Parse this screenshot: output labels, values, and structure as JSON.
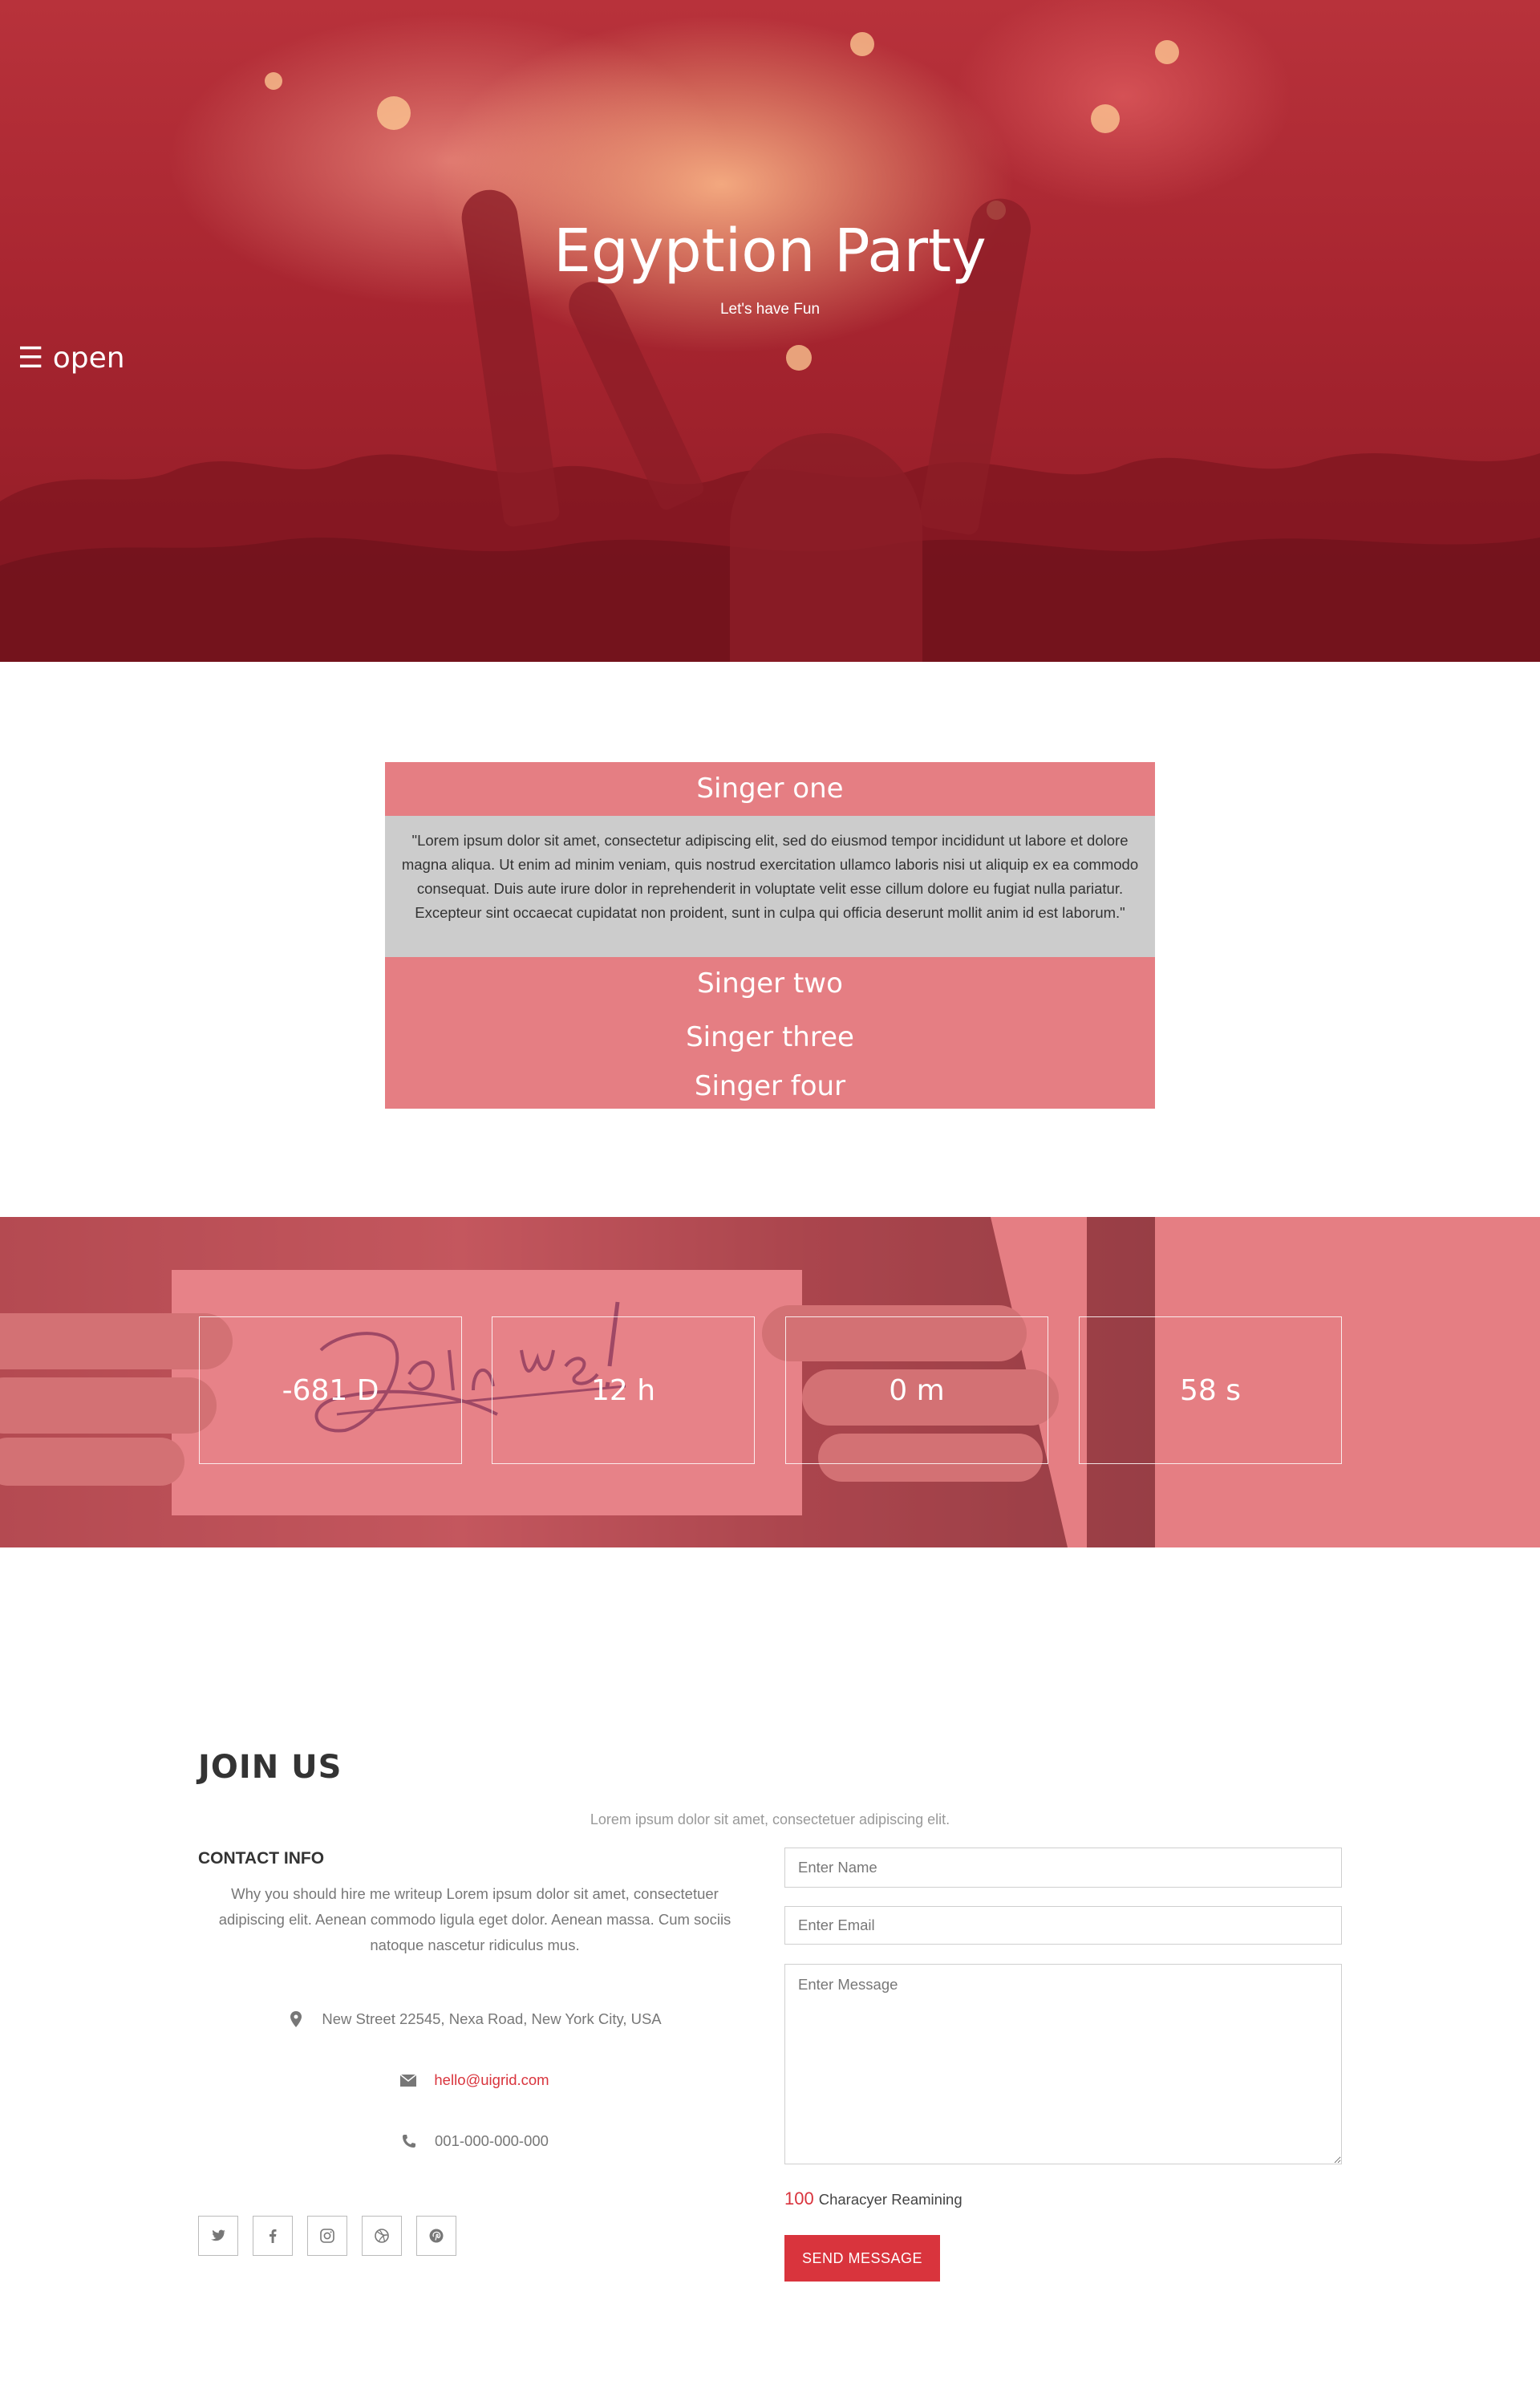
{
  "hero": {
    "title": "Egyption Party",
    "subtitle": "Let's have Fun",
    "menu_toggle": "☰ open",
    "menu_toggle_icon": "hamburger-icon"
  },
  "accordion": {
    "items": [
      {
        "title": "Singer one",
        "expanded": true,
        "body": "\"Lorem ipsum dolor sit amet, consectetur adipiscing elit, sed do eiusmod tempor incididunt ut labore et dolore magna aliqua. Ut enim ad minim veniam, quis nostrud exercitation ullamco laboris nisi ut aliquip ex ea commodo consequat. Duis aute irure dolor in reprehenderit in voluptate velit esse cillum dolore eu fugiat nulla pariatur. Excepteur sint occaecat cupidatat non proident, sunt in culpa qui officia deserunt mollit anim id est laborum.\""
      },
      {
        "title": "Singer two",
        "expanded": false
      },
      {
        "title": "Singer three",
        "expanded": false
      },
      {
        "title": "Singer four",
        "expanded": false
      }
    ]
  },
  "countdown": {
    "days": "-681 D",
    "hours": "12 h",
    "minutes": "0 m",
    "seconds": "58 s"
  },
  "join": {
    "title": "JOIN US",
    "subtitle": "Lorem ipsum dolor sit amet, consectetuer adipiscing elit.",
    "contact": {
      "title": "CONTACT INFO",
      "text": "Why you should hire me writeup Lorem ipsum dolor sit amet, consectetuer adipiscing elit. Aenean commodo ligula eget dolor. Aenean massa. Cum sociis natoque nascetur ridiculus mus.",
      "address": "New Street 22545, Nexa Road, New York City, USA",
      "email": "hello@uigrid.com",
      "phone": "001-000-000-000",
      "socials": [
        "twitter-icon",
        "facebook-icon",
        "instagram-icon",
        "dribbble-icon",
        "pinterest-icon"
      ]
    },
    "form": {
      "name_placeholder": "Enter Name",
      "email_placeholder": "Enter Email",
      "message_placeholder": "Enter Message",
      "chars_remaining": "100",
      "chars_label": "Characyer Reamining",
      "send_label": "SEND MESSAGE"
    }
  },
  "colors": {
    "accent": "#d9343d",
    "accordion": "#e57e83",
    "accordion_body": "#cccccc"
  }
}
